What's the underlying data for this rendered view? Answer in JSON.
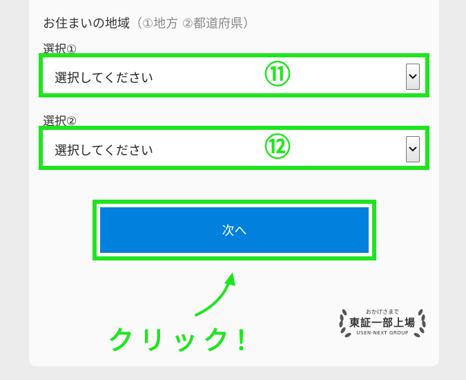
{
  "form": {
    "region_label": "お住まいの地域",
    "region_sub": "（①地方 ②都道府県）",
    "select1": {
      "label": "選択①",
      "value": "選択してください",
      "callout": "⑪"
    },
    "select2": {
      "label": "選択②",
      "value": "選択してください",
      "callout": "⑫"
    },
    "next_button": "次へ"
  },
  "annotation": {
    "click_text": "クリック！"
  },
  "badge": {
    "top": "おかげさまで",
    "main": "東証一部上場",
    "bottom": "USEN-NEXT GROUP"
  },
  "icons": {
    "dropdown": "chevron-down-icon",
    "arrow": "curved-arrow-icon",
    "laurel": "laurel-wreath-icon"
  },
  "colors": {
    "highlight": "#1ee51e",
    "button": "#0180dd"
  }
}
